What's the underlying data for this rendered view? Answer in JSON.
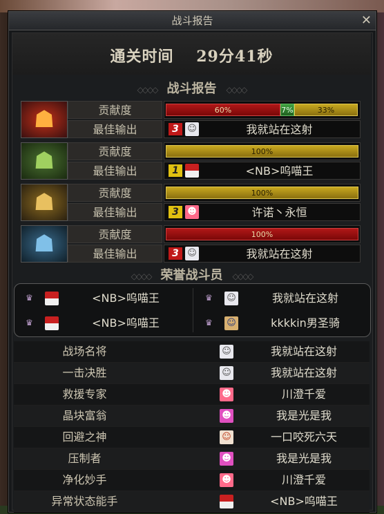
{
  "window": {
    "title": "战斗报告",
    "close_label": "✕"
  },
  "clear_time": {
    "label": "通关时间",
    "value": "29分41秒"
  },
  "battle_report": {
    "title": "战斗报告",
    "bosses": [
      {
        "icon": "fire-mask-icon",
        "contribution_label": "贡献度",
        "best_output_label": "最佳输出",
        "bars": [
          {
            "pct": 60,
            "text": "60%",
            "color": "red"
          },
          {
            "pct": 7,
            "text": "7%",
            "color": "green"
          },
          {
            "pct": 33,
            "text": "33%",
            "color": "gold"
          }
        ],
        "best_rank": "3",
        "best_player": "我就站在这射"
      },
      {
        "icon": "green-mask-icon",
        "contribution_label": "贡献度",
        "best_output_label": "最佳输出",
        "bars": [
          {
            "pct": 100,
            "text": "100%",
            "color": "gold"
          }
        ],
        "best_rank": "1",
        "best_player": "<NB>呜喵王"
      },
      {
        "icon": "gold-mask-icon",
        "contribution_label": "贡献度",
        "best_output_label": "最佳输出",
        "bars": [
          {
            "pct": 100,
            "text": "100%",
            "color": "gold"
          }
        ],
        "best_rank": "3",
        "best_player": "许诺丶永恒"
      },
      {
        "icon": "blue-mask-icon",
        "contribution_label": "贡献度",
        "best_output_label": "最佳输出",
        "bars": [
          {
            "pct": 100,
            "text": "100%",
            "color": "red"
          }
        ],
        "best_rank": "3",
        "best_player": "我就站在这射"
      }
    ]
  },
  "honor": {
    "title": "荣誉战斗员",
    "members": [
      {
        "name": "<NB>呜喵王"
      },
      {
        "name": "我就站在这射"
      },
      {
        "name": "<NB>呜喵王"
      },
      {
        "name": "kkkkin男圣骑"
      }
    ]
  },
  "awards": [
    {
      "title": "战场名将",
      "player": "我就站在这射"
    },
    {
      "title": "一击决胜",
      "player": "我就站在这射"
    },
    {
      "title": "救援专家",
      "player": "川澄千爱"
    },
    {
      "title": "晶块富翁",
      "player": "我是光是我"
    },
    {
      "title": "回避之神",
      "player": "一口咬死六天"
    },
    {
      "title": "压制者",
      "player": "我是光是我"
    },
    {
      "title": "净化妙手",
      "player": "川澄千爱"
    },
    {
      "title": "异常状态能手",
      "player": "<NB>呜喵王"
    }
  ]
}
